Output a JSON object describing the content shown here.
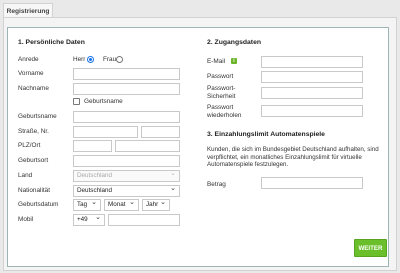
{
  "tab": {
    "label": "Registrierung"
  },
  "personal": {
    "heading": "1. Persönliche Daten",
    "anrede_label": "Anrede",
    "herr_label": "Herr",
    "frau_label": "Frau",
    "vorname_label": "Vorname",
    "nachname_label": "Nachname",
    "geburtsname_checkbox_label": "Geburtsname",
    "geburtsname_label": "Geburtsname",
    "strasse_label": "Straße, Nr.",
    "plz_label": "PLZ/Ort",
    "geburtsort_label": "Geburtsort",
    "land_label": "Land",
    "land_value": "Deutschland",
    "nationalitaet_label": "Nationalität",
    "nationalitaet_value": "Deutschland",
    "geburtsdatum_label": "Geburtsdatum",
    "tag_value": "Tag",
    "monat_value": "Monat",
    "jahr_value": "Jahr",
    "mobil_label": "Mobil",
    "mobil_prefix": "+49"
  },
  "access": {
    "heading": "2. Zugangsdaten",
    "email_label": "E-Mail",
    "passwort_label": "Passwort",
    "sicherheit_label_1": "Passwort-",
    "sicherheit_label_2": "Sicherheit",
    "wiederholen_label_1": "Passwort",
    "wiederholen_label_2": "wiederholen"
  },
  "limit": {
    "heading": "3. Einzahlungslimit Automatenspiele",
    "line1": "Kunden, die sich im Bundesgebiet Deutschland aufhalten, sind",
    "line2": "verpflichtet, ein monatliches Einzahlungslimit für virtuelle",
    "line3": "Automatenspiele festzulegen.",
    "betrag_label": "Betrag"
  },
  "actions": {
    "weiter_label": "WEITER"
  },
  "icons": {
    "info": "info-icon"
  },
  "colors": {
    "accent_green": "#6abf2b",
    "radio_blue": "#1a73e8",
    "panel_border": "#9fb4b4"
  }
}
